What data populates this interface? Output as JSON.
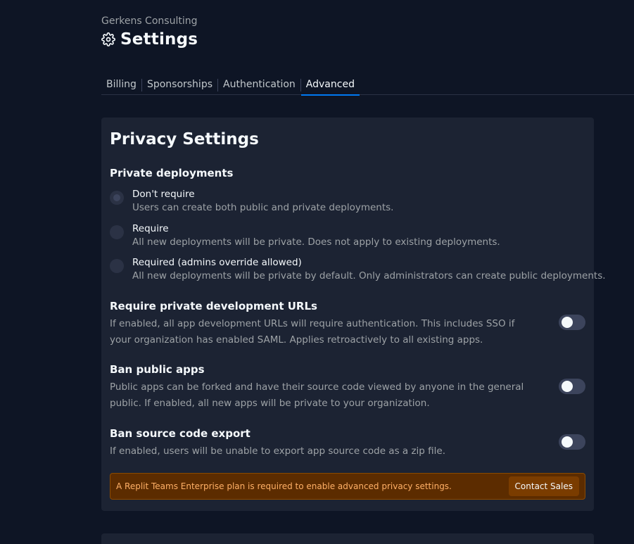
{
  "header": {
    "org_name": "Gerkens Consulting",
    "title": "Settings",
    "title_icon": "gear-icon"
  },
  "tabs": [
    {
      "label": "Billing",
      "active": false
    },
    {
      "label": "Sponsorships",
      "active": false
    },
    {
      "label": "Authentication",
      "active": false
    },
    {
      "label": "Advanced",
      "active": true
    }
  ],
  "privacy": {
    "title": "Privacy Settings",
    "private_deployments": {
      "heading": "Private deployments",
      "options": [
        {
          "label": "Don't require",
          "description": "Users can create both public and private deployments.",
          "selected": true
        },
        {
          "label": "Require",
          "description": "All new deployments will be private. Does not apply to existing deployments.",
          "selected": false
        },
        {
          "label": "Required (admins override allowed)",
          "description": "All new deployments will be private by default. Only administrators can create public deployments.",
          "selected": false
        }
      ]
    },
    "settings": [
      {
        "heading": "Require private development URLs",
        "description": "If enabled, all app development URLs will require authentication. This includes SSO if your organization has enabled SAML. Applies retroactively to all existing apps.",
        "enabled": false
      },
      {
        "heading": "Ban public apps",
        "description": "Public apps can be forked and have their source code viewed by anyone in the general public. If enabled, all new apps will be private to your organization.",
        "enabled": false
      },
      {
        "heading": "Ban source code export",
        "description": "If enabled, users will be unable to export app source code as a zip file.",
        "enabled": false
      }
    ],
    "notice": {
      "text": "A Replit Teams Enterprise plan is required to enable advanced privacy settings.",
      "button_label": "Contact Sales"
    }
  },
  "colors": {
    "background": "#0e1525",
    "card": "#1c2333",
    "accent": "#0079f2",
    "notice_bg": "#5c2c00",
    "notice_text": "#ffb066"
  }
}
